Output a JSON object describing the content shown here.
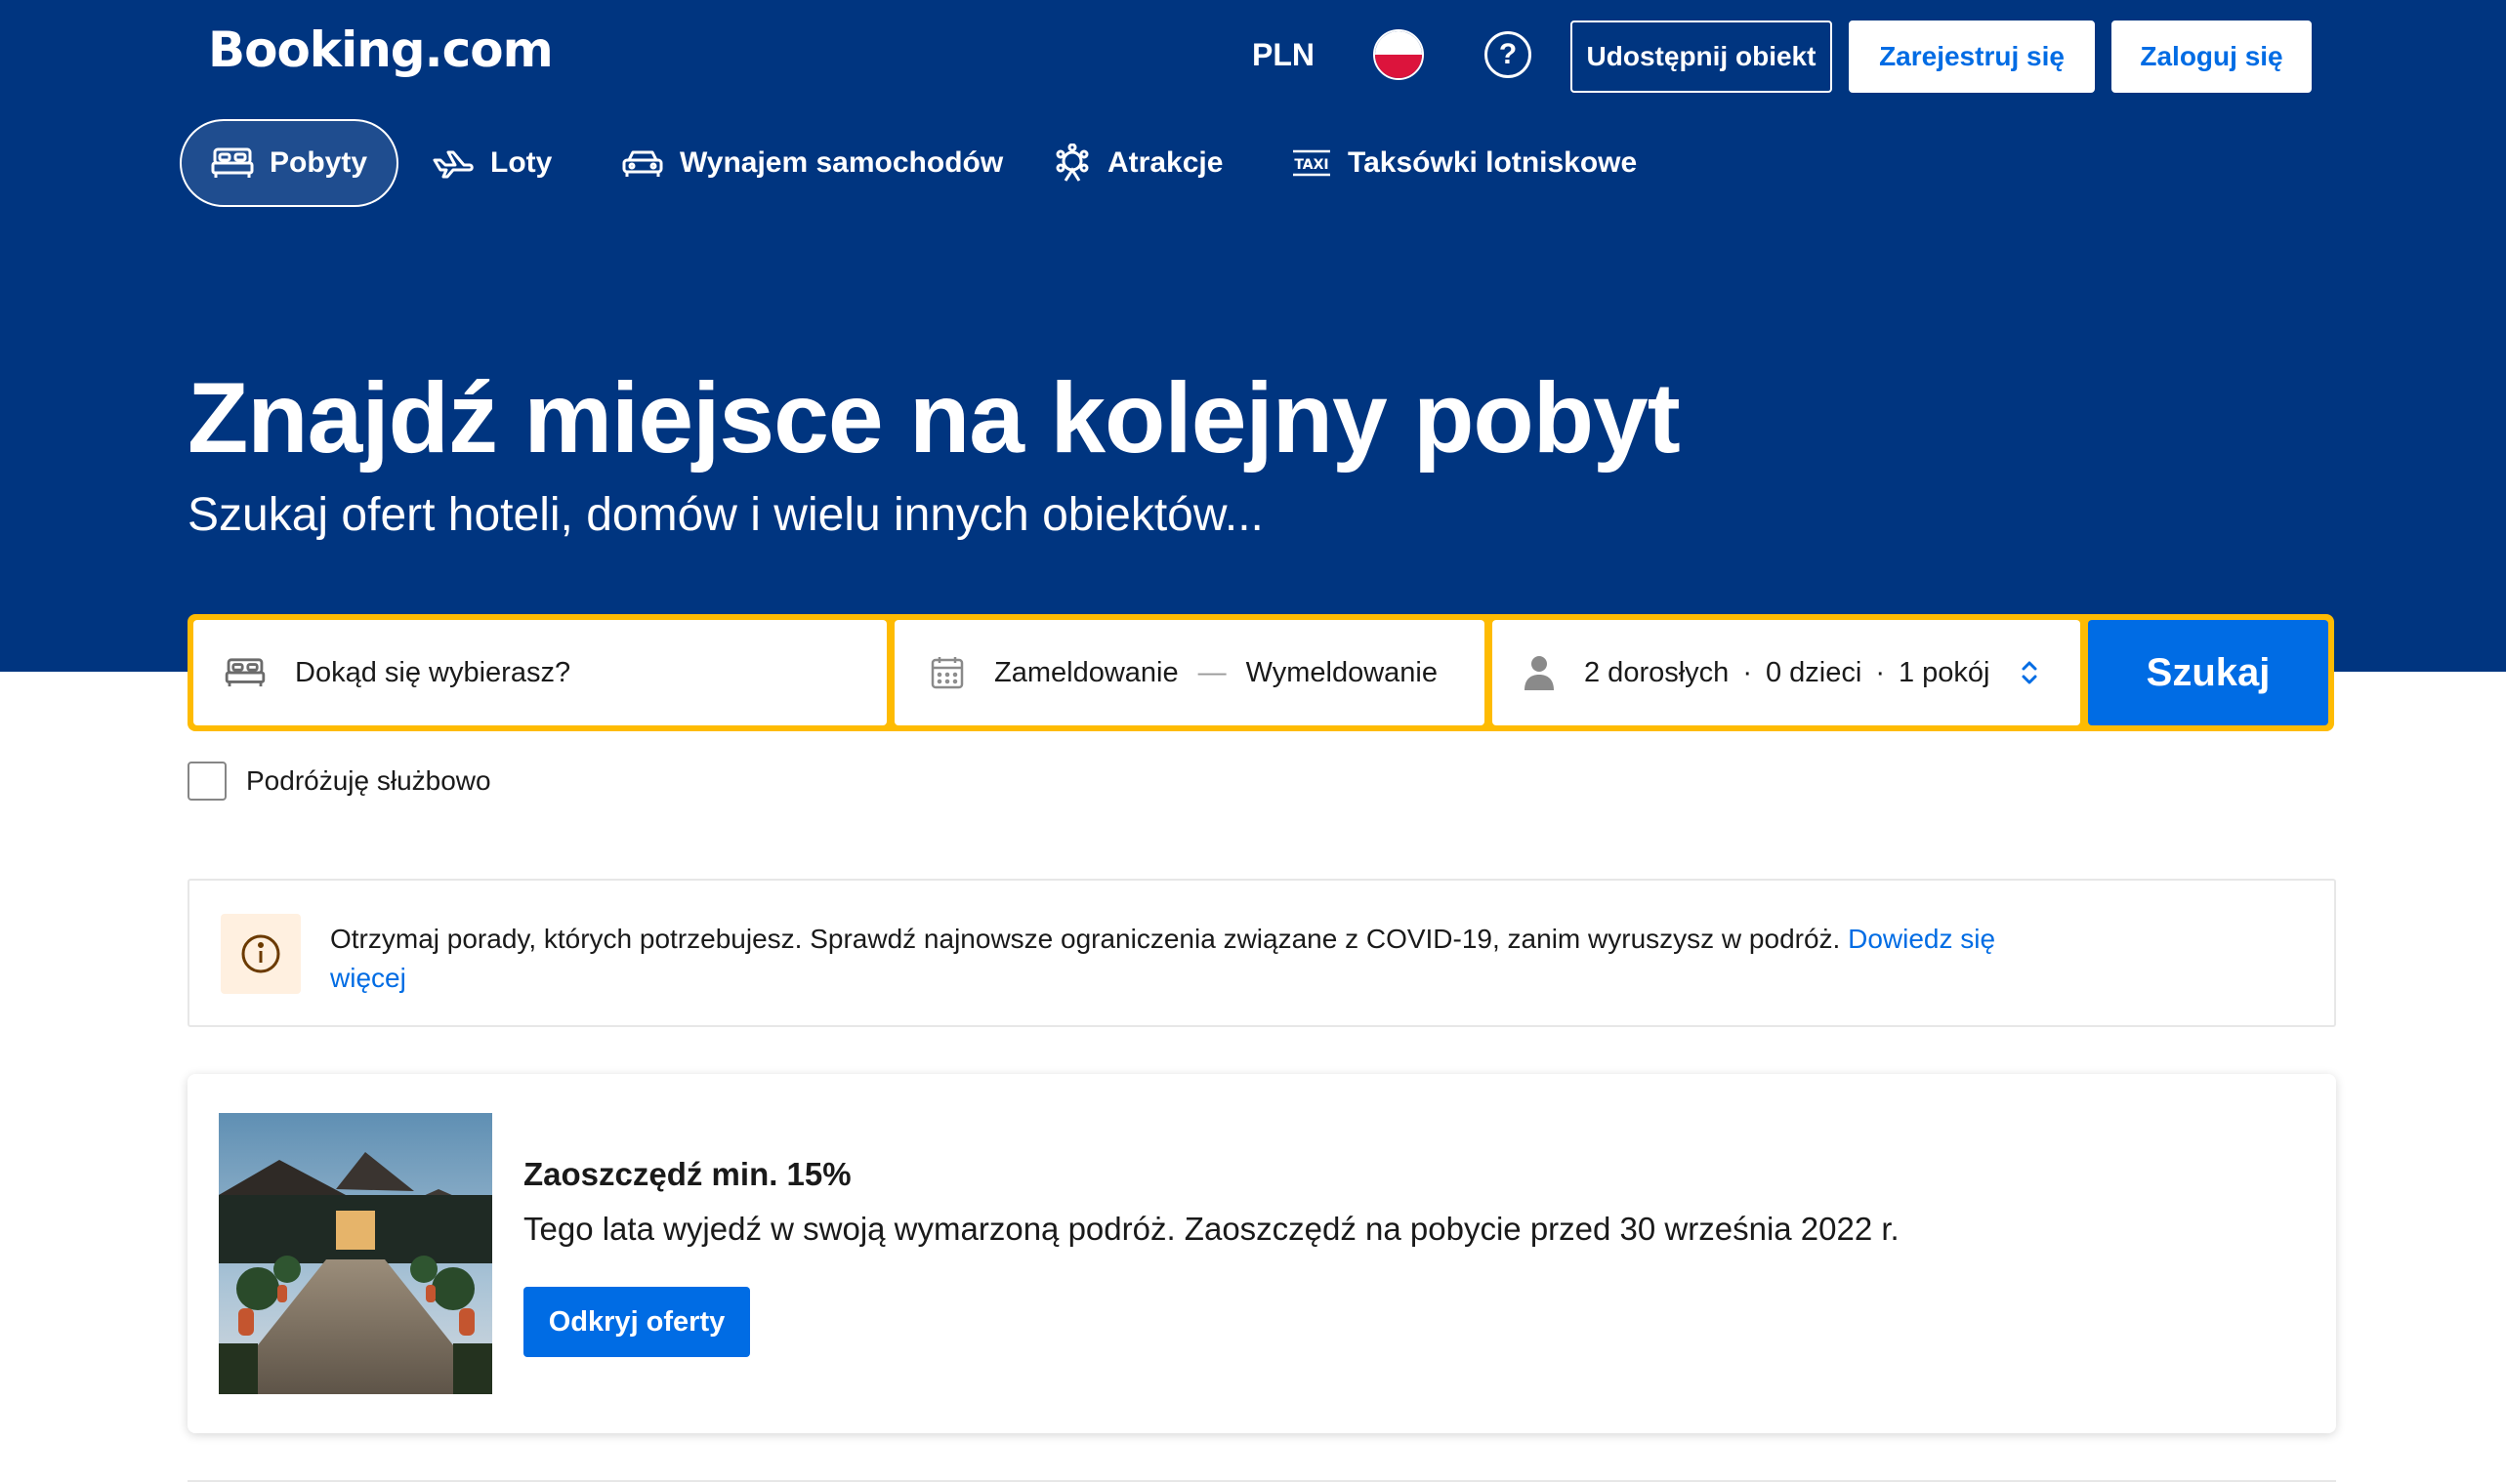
{
  "header": {
    "logo": "Booking.com",
    "currency": "PLN",
    "help_symbol": "?",
    "list_property": "Udostępnij obiekt",
    "register": "Zarejestruj się",
    "login": "Zaloguj się"
  },
  "nav": {
    "items": [
      {
        "label": "Pobyty",
        "icon": "bed-icon",
        "active": true
      },
      {
        "label": "Loty",
        "icon": "plane-icon"
      },
      {
        "label": "Wynajem samochodów",
        "icon": "car-icon"
      },
      {
        "label": "Atrakcje",
        "icon": "attraction-icon"
      },
      {
        "label": "Taksówki lotniskowe",
        "icon": "taxi-icon"
      }
    ]
  },
  "hero": {
    "title": "Znajdź miejsce na kolejny pobyt",
    "subtitle": "Szukaj ofert hoteli, domów i wielu innych obiektów..."
  },
  "search": {
    "destination_placeholder": "Dokąd się wybierasz?",
    "checkin": "Zameldowanie",
    "separator": "—",
    "checkout": "Wymeldowanie",
    "adults": "2 dorosłych",
    "children": "0 dzieci",
    "rooms": "1 pokój",
    "dot": "·",
    "button": "Szukaj"
  },
  "business_travel": {
    "label": "Podróżuję służbowo",
    "checked": false
  },
  "covid_notice": {
    "text": "Otrzymaj porady, których potrzebujesz. Sprawdź najnowsze ograniczenia związane z COVID-19, zanim wyruszysz w podróż.",
    "link": "Dowiedz się więcej"
  },
  "promo": {
    "title": "Zaoszczędź min. 15%",
    "description": "Tego lata wyjedź w swoją wymarzoną podróż. Zaoszczędź na pobycie przed 30 września 2022 r.",
    "button": "Odkryj oferty"
  },
  "colors": {
    "brand_blue": "#003580",
    "action_blue": "#006ce4",
    "search_border": "#febb02"
  }
}
